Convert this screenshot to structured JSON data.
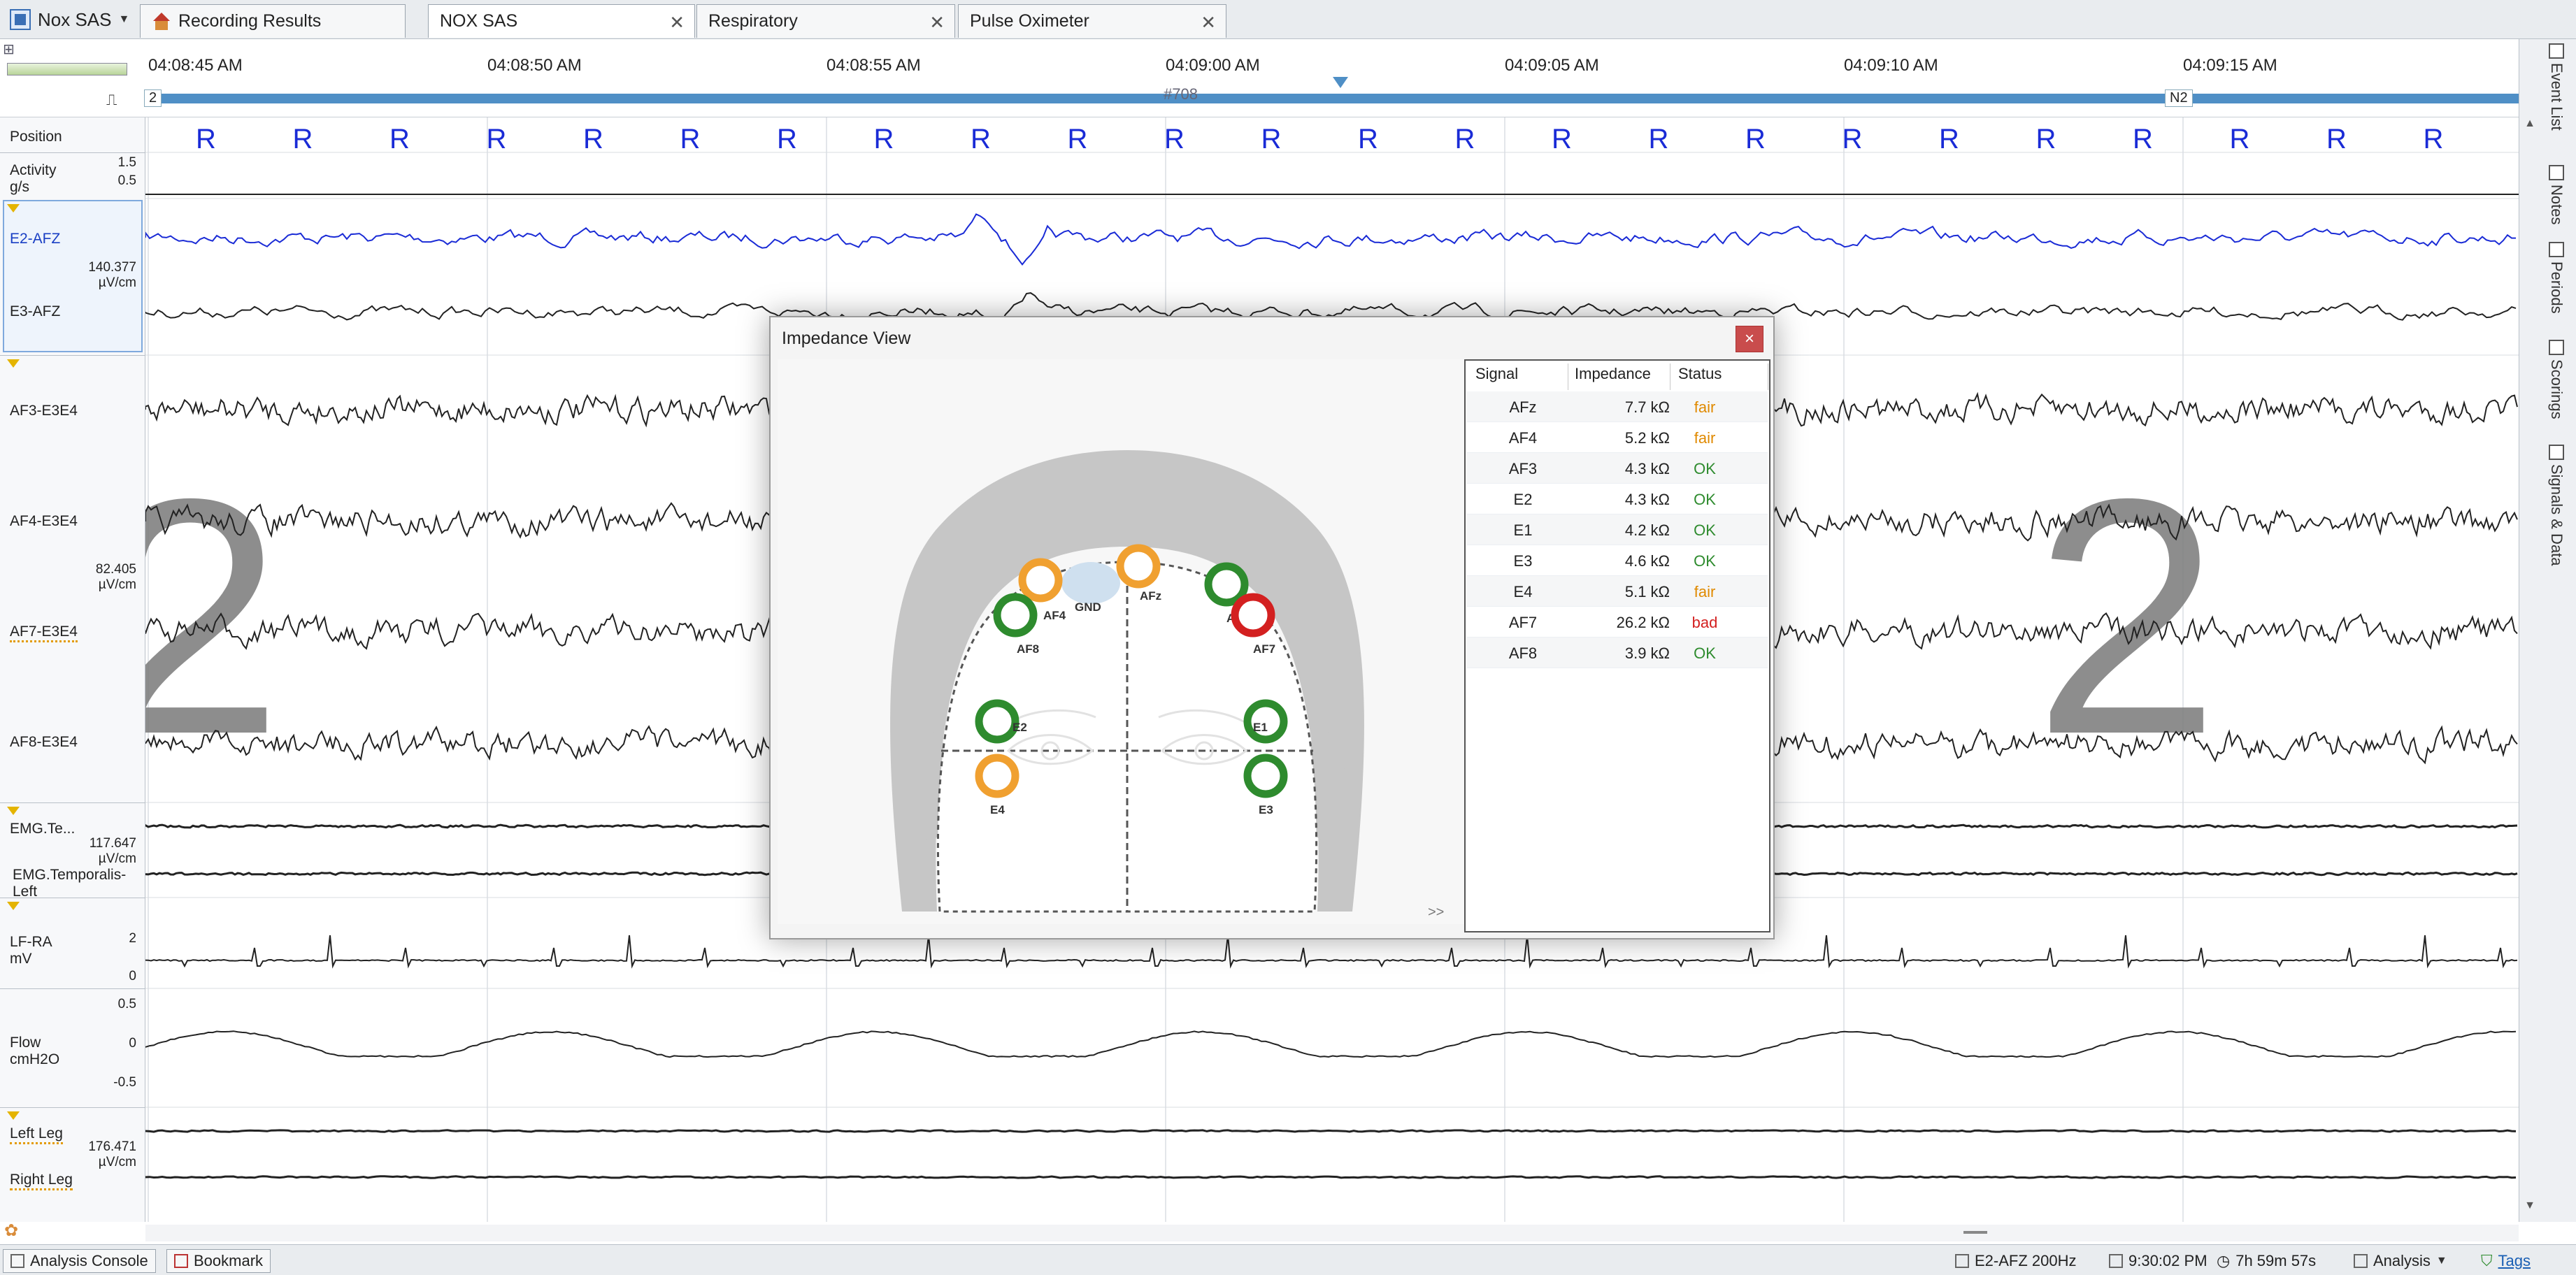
{
  "app": {
    "name": "Nox SAS"
  },
  "tabs": [
    {
      "label": "Recording Results"
    },
    {
      "label": "NOX SAS"
    },
    {
      "label": "Respiratory"
    },
    {
      "label": "Pulse Oximeter"
    }
  ],
  "ruler": {
    "times": [
      "04:08:45 AM",
      "04:08:50 AM",
      "04:08:55 AM",
      "04:09:00 AM",
      "04:09:05 AM",
      "04:09:10 AM",
      "04:09:15 AM"
    ],
    "stage_left": "2",
    "stage_right": "N2",
    "epoch": "#708"
  },
  "channels": {
    "position": {
      "label": "Position",
      "marker": "R"
    },
    "activity": {
      "label": "Activity",
      "unit": "g/s",
      "scale_top": "1.5",
      "scale_mid": "0.5"
    },
    "eog": {
      "ch1": "E2-AFZ",
      "ch2": "E3-AFZ",
      "scale": "140.377",
      "unit": "µV/cm"
    },
    "eeg": {
      "ch1": "AF3-E3E4",
      "ch2": "AF4-E3E4",
      "ch3": "AF7-E3E4",
      "ch4": "AF8-E3E4",
      "scale": "82.405",
      "unit": "µV/cm"
    },
    "emg": {
      "ch1": "EMG.Te...",
      "ch2": "EMG.Temporalis-Left",
      "scale": "117.647",
      "unit": "µV/cm"
    },
    "ecg": {
      "label": "LF-RA",
      "unit": "mV",
      "scale_top": "2",
      "scale_bottom": "0"
    },
    "flow": {
      "label": "Flow",
      "unit": "cmH2O",
      "scale_top": "0.5",
      "scale_mid": "0",
      "scale_bottom": "-0.5"
    },
    "legs": {
      "ch1": "Left Leg",
      "ch2": "Right Leg",
      "scale": "176.471",
      "unit": "µV/cm"
    }
  },
  "stage_overlay": "2",
  "side_panel": [
    "Event List",
    "Notes",
    "Periods",
    "Scorings",
    "Signals & Data"
  ],
  "status": {
    "analysis_console": "Analysis Console",
    "bookmark": "Bookmark",
    "signal": "E2-AFZ 200Hz",
    "clock": "9:30:02 PM",
    "duration": "7h 59m 57s",
    "mode": "Analysis",
    "tags": "Tags"
  },
  "impedance": {
    "title": "Impedance View",
    "close": "×",
    "expand": ">>",
    "gnd": "GND",
    "columns": {
      "signal": "Signal",
      "impedance": "Impedance",
      "status": "Status"
    },
    "rows": [
      {
        "signal": "AFz",
        "impedance": "7.7 kΩ",
        "status": "fair"
      },
      {
        "signal": "AF4",
        "impedance": "5.2 kΩ",
        "status": "fair"
      },
      {
        "signal": "AF3",
        "impedance": "4.3 kΩ",
        "status": "OK"
      },
      {
        "signal": "E2",
        "impedance": "4.3 kΩ",
        "status": "OK"
      },
      {
        "signal": "E1",
        "impedance": "4.2 kΩ",
        "status": "OK"
      },
      {
        "signal": "E3",
        "impedance": "4.6 kΩ",
        "status": "OK"
      },
      {
        "signal": "E4",
        "impedance": "5.1 kΩ",
        "status": "fair"
      },
      {
        "signal": "AF7",
        "impedance": "26.2 kΩ",
        "status": "bad"
      },
      {
        "signal": "AF8",
        "impedance": "3.9 kΩ",
        "status": "OK"
      }
    ],
    "status_colors": {
      "OK": "#2e8b2e",
      "fair": "#f0a030",
      "bad": "#d32020"
    }
  }
}
